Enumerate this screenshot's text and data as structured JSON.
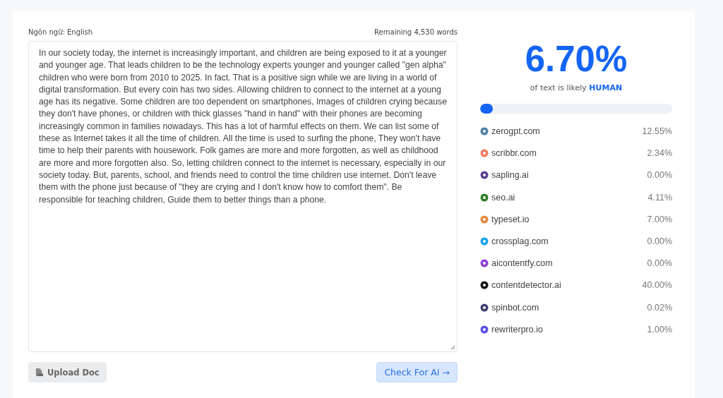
{
  "editor": {
    "language_label": "Ngôn ngữ: English",
    "remaining": "Remaining 4,530 words",
    "text": "In our society today, the internet is increasingly important, and children are being exposed to it at a younger and younger age. That leads children to be the technology experts younger and younger called \"gen alpha\" children who were born from 2010 to 2025. In fact. That is a positive sign while we are living in a world of digital transformation. But every coin has two sides. Allowing children to connect to the internet at a young age has its negative. Some children are too dependent on smartphones, Images of children crying because they don't have phones, or children with thick glasses \"hand in hand\" with their phones are becoming increasingly common in families nowadays. This has a lot of harmful effects on them. We can list some of these as Internet takes it all the time of children. All the time is used to surfing the phone, They won't have time to help their parents with housework. Folk games are more and more forgotten, as well as childhood are more and more forgotten also. So, letting children connect to the internet is necessary, especially in our society today. But, parents, school, and friends need to control the time children use internet. Don't leave them with the phone just because of \"they are crying and I don't know how to comfort them\". Be responsible for teaching children, Guide them to better things than a phone.",
    "upload_button": "Upload Doc",
    "check_button": "Check For AI →"
  },
  "result": {
    "score": "6.70%",
    "caption": "of text is likely",
    "verdict": "HUMAN",
    "level": 0.067,
    "sources": [
      {
        "name": "zerogpt.com",
        "value": "12.55%",
        "color": "#4a7fa8"
      },
      {
        "name": "scribbr.com",
        "value": "2.34%",
        "color": "#f07b5c"
      },
      {
        "name": "sapling.ai",
        "value": "0.00%",
        "color": "#5b3f8f"
      },
      {
        "name": "seo.ai",
        "value": "4.11%",
        "color": "#2f7d2a"
      },
      {
        "name": "typeset.io",
        "value": "7.00%",
        "color": "#e08a3c"
      },
      {
        "name": "crossplag.com",
        "value": "0.00%",
        "color": "#1aa3e8"
      },
      {
        "name": "aicontentfy.com",
        "value": "0.00%",
        "color": "#8e3fd6"
      },
      {
        "name": "contentdetector.ai",
        "value": "40.00%",
        "color": "#111111"
      },
      {
        "name": "spinbot.com",
        "value": "0.02%",
        "color": "#3d3f70"
      },
      {
        "name": "rewriterpro.io",
        "value": "1.00%",
        "color": "#5b4fe0"
      }
    ]
  }
}
